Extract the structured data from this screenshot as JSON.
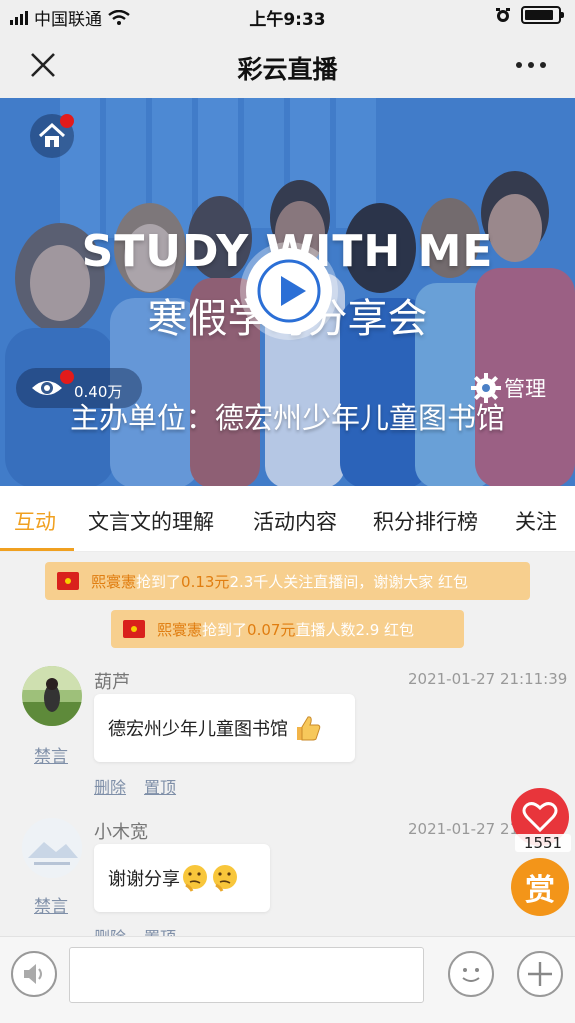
{
  "status_bar": {
    "carrier": "中国联通",
    "time": "上午9:33"
  },
  "nav": {
    "title": "彩云直播",
    "close_icon": "close-icon",
    "more_icon": "more-icon"
  },
  "banner": {
    "headline": "STUDY WITH ME",
    "subhead": "寒假学习分享会",
    "organizer": "主办单位：德宏州少年儿童图书馆",
    "views": "0.40万",
    "manage_label": "管理",
    "home_icon": "home-icon",
    "play_icon": "play-icon",
    "eye_icon": "eye-icon",
    "gear_icon": "gear-icon"
  },
  "tabs": [
    {
      "label": "互动",
      "active": true
    },
    {
      "label": "文言文的理解",
      "active": false
    },
    {
      "label": "活动内容",
      "active": false
    },
    {
      "label": "积分排行榜",
      "active": false
    },
    {
      "label": "关注",
      "active": false
    }
  ],
  "red_packets": [
    {
      "name": "熙寰憲",
      "action": "抢到了",
      "amount": "0.13元",
      "message": "2.3千人关注直播间，谢谢大家 红包"
    },
    {
      "name": "熙寰憲",
      "action": "抢到了",
      "amount": "0.07元",
      "message": "直播人数2.9 红包"
    }
  ],
  "messages": [
    {
      "user": "葫芦",
      "time": "2021-01-27 21:11:39",
      "text": "德宏州少年儿童图书馆",
      "mute": "禁言",
      "delete": "删除",
      "pin": "置顶",
      "emoji": "thumbs-up-icon"
    },
    {
      "user": "小木宽",
      "time": "2021-01-27 21",
      "text": "谢谢分享",
      "mute": "禁言",
      "delete": "删除",
      "pin": "置顶",
      "emoji": "thinking-face-icon"
    }
  ],
  "fab": {
    "like_count": "1551",
    "reward_label": "赏"
  },
  "colors": {
    "accent": "#f0a020",
    "red_packet_bg": "#f7cf8e",
    "like": "#e8353b",
    "reward": "#f39519"
  }
}
